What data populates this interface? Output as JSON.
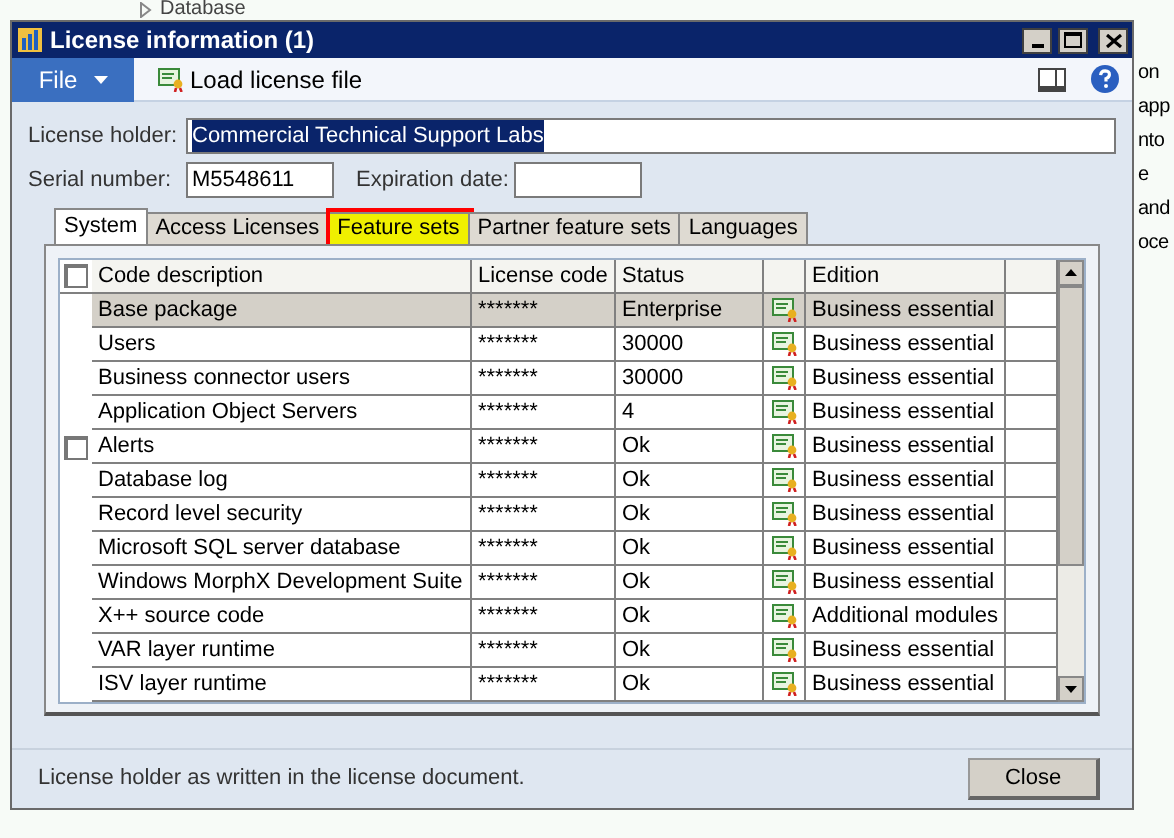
{
  "background": {
    "tree_item": "Database",
    "side_texts": [
      "on",
      "app",
      "nto",
      "e",
      "and",
      "oce"
    ]
  },
  "window": {
    "title": "License information (1)"
  },
  "toolbar": {
    "file_menu": "File",
    "load_button": "Load license file"
  },
  "form": {
    "license_holder": {
      "label": "License holder:",
      "value": "Commercial Technical Support Labs",
      "text_selected": true
    },
    "serial_number": {
      "label": "Serial number:",
      "value": "M5548611"
    },
    "expiration_date": {
      "label": "Expiration date:"
    }
  },
  "tabs": [
    {
      "label": "System",
      "selected": true,
      "highlighted": false
    },
    {
      "label": "Access Licenses",
      "selected": false,
      "highlighted": false
    },
    {
      "label": "Feature sets",
      "selected": false,
      "highlighted": true
    },
    {
      "label": "Partner feature sets",
      "selected": false,
      "highlighted": false
    },
    {
      "label": "Languages",
      "selected": false,
      "highlighted": false
    }
  ],
  "table": {
    "header_checked": false,
    "columns": [
      "Code description",
      "License code",
      "Status",
      "Edition"
    ],
    "rows": [
      {
        "description": "Base package",
        "license_code": "*******",
        "status": "Enterprise",
        "edition": "Business essential",
        "selected": true
      },
      {
        "description": "Users",
        "license_code": "*******",
        "status": "30000",
        "edition": "Business essential",
        "selected": false
      },
      {
        "description": "Business connector users",
        "license_code": "*******",
        "status": "30000",
        "edition": "Business essential",
        "selected": false
      },
      {
        "description": "Application Object Servers",
        "license_code": "*******",
        "status": "4",
        "edition": "Business essential",
        "selected": false
      },
      {
        "description": "Alerts",
        "license_code": "*******",
        "status": "Ok",
        "edition": "Business essential",
        "selected": false,
        "checked": false
      },
      {
        "description": "Database log",
        "license_code": "*******",
        "status": "Ok",
        "edition": "Business essential",
        "selected": false
      },
      {
        "description": "Record level security",
        "license_code": "*******",
        "status": "Ok",
        "edition": "Business essential",
        "selected": false
      },
      {
        "description": "Microsoft SQL server database",
        "license_code": "*******",
        "status": "Ok",
        "edition": "Business essential",
        "selected": false
      },
      {
        "description": "Windows MorphX Development Suite",
        "license_code": "*******",
        "status": "Ok",
        "edition": "Business essential",
        "selected": false
      },
      {
        "description": "X++ source code",
        "license_code": "*******",
        "status": "Ok",
        "edition": "Additional modules",
        "selected": false
      },
      {
        "description": "VAR layer runtime",
        "license_code": "*******",
        "status": "Ok",
        "edition": "Business essential",
        "selected": false
      },
      {
        "description": "ISV layer runtime",
        "license_code": "*******",
        "status": "Ok",
        "edition": "Business essential",
        "selected": false
      }
    ]
  },
  "status_bar": {
    "text": "License holder as written in the license document.",
    "close_button": "Close"
  }
}
